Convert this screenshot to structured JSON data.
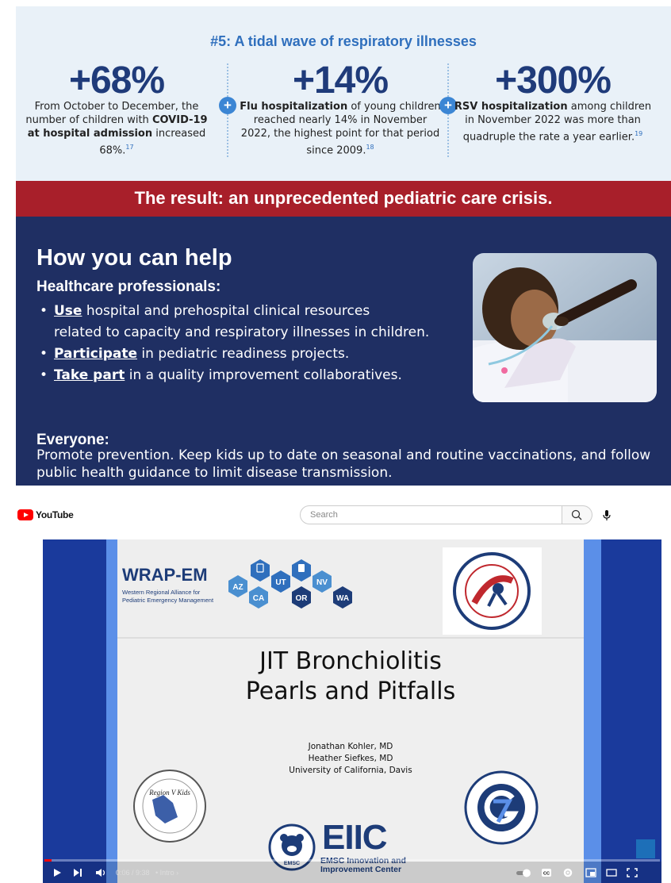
{
  "infographic": {
    "stats_title": "#5: A tidal wave of respiratory illnesses",
    "stats": [
      {
        "big": "+68%",
        "pre": "From October to December, the number of children with",
        "bold": "COVID-19 at hospital admission",
        "post": "increased 68%.",
        "ref": "17"
      },
      {
        "big": "+14%",
        "pre": "",
        "bold": "Flu hospitalization",
        "post": "of young children reached nearly 14% in November 2022, the highest point for that period since 2009.",
        "ref": "18"
      },
      {
        "big": "+300%",
        "pre": "",
        "bold": "RSV hospitalization",
        "post": "among children in November 2022 was more than quadruple the rate a year earlier.",
        "ref": "19"
      }
    ],
    "result_banner": "The result: an unprecedented pediatric care crisis.",
    "help_title": "How you can help",
    "hp_title": "Healthcare professionals:",
    "bullets": [
      {
        "link": "Use",
        "text": " hospital and prehospital clinical resources",
        "text2": "related to capacity and respiratory illnesses in children."
      },
      {
        "link": "Participate",
        "text": " in pediatric readiness projects.",
        "text2": ""
      },
      {
        "link": "Take part",
        "text": " in a quality improvement collaboratives.",
        "text2": ""
      }
    ],
    "everyone_title": "Everyone:",
    "everyone_text": "Promote prevention. Keep kids up to date on seasonal and routine vaccinations, and follow public health guidance to limit disease transmission."
  },
  "youtube": {
    "logo_text": "YouTube",
    "search_placeholder": "Search",
    "slide": {
      "wrap_title": "WRAP-EM",
      "wrap_sub1": "Western Regional Alliance for",
      "wrap_sub2": "Pediatric Emergency Management",
      "states": [
        "AZ",
        "CA",
        "NV",
        "OR",
        "WA",
        "UT"
      ],
      "title_line1": "JIT Bronchiolitis",
      "title_line2": "Pearls and Pitfalls",
      "authors": [
        "Jonathan Kohler, MD",
        "Heather Siefkes, MD",
        "University of California, Davis"
      ],
      "eiic": "EIIC",
      "eiic_sub1": "EMSC Innovation and",
      "eiic_sub2": "Improvement Center",
      "emsc_label": "EMSC",
      "region_label": "Region V Kids"
    },
    "player": {
      "time": "0:06 / 9:38",
      "chapter": "• Intro ›",
      "progress_fraction": 0.011
    }
  }
}
